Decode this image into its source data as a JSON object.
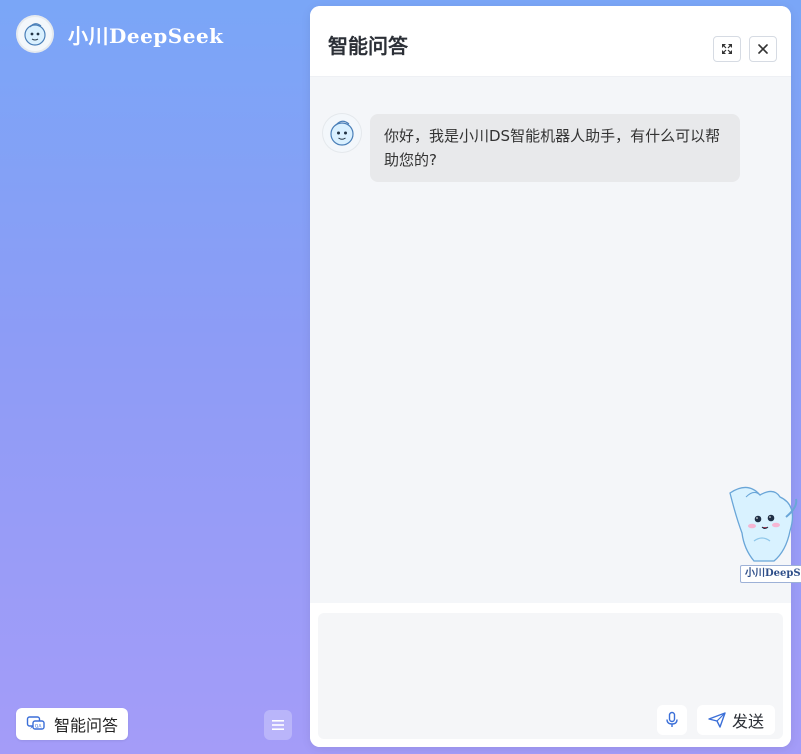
{
  "brand": {
    "title": "小川DeepSeek",
    "logo_icon": "mascot-avatar"
  },
  "sidebar": {
    "nav_item_label": "智能问答",
    "nav_item_icon": "qa-chat-icon",
    "menu_icon": "hamburger-menu-icon"
  },
  "chat": {
    "title": "智能问答",
    "header_actions": {
      "expand_icon": "expand-icon",
      "close_icon": "close-icon"
    },
    "messages": [
      {
        "sender": "assistant",
        "avatar_icon": "mascot-avatar",
        "text": "你好，我是小川DS智能机器人助手，有什么可以帮助您的?"
      }
    ],
    "input": {
      "placeholder": "",
      "value": "",
      "mic_icon": "microphone-icon",
      "send_icon": "send-plane-icon",
      "send_label": "发送"
    }
  },
  "floating_mascot": {
    "label": "小川DeepSeek"
  },
  "colors": {
    "background_top": "#7aa6f7",
    "background_bottom": "#a49cf8",
    "chat_bg": "#f4f6f9",
    "bubble_bg": "#e8e9eb"
  }
}
